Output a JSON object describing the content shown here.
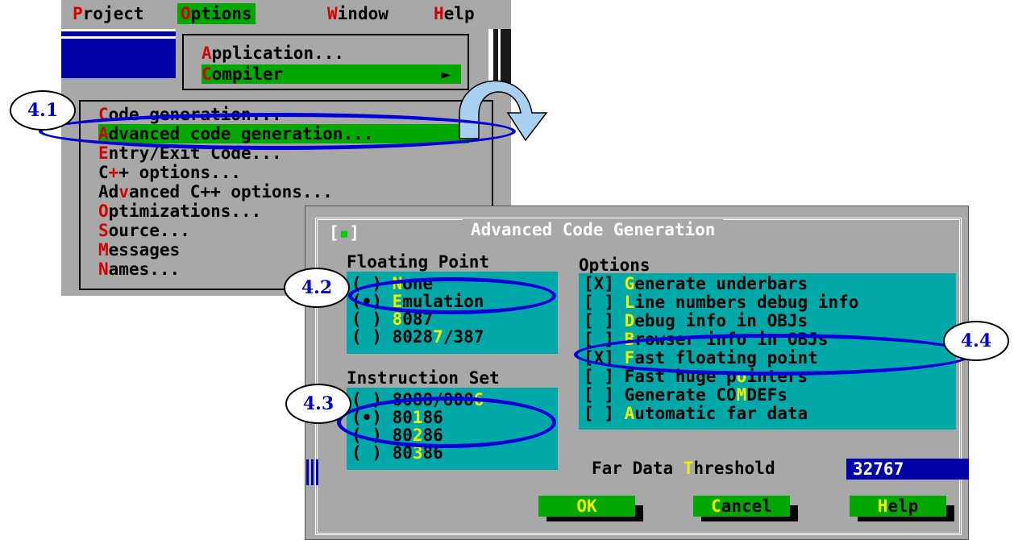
{
  "menubar": {
    "items": [
      {
        "label": "Project",
        "hotkey": "P"
      },
      {
        "label": "Options",
        "hotkey": "O"
      },
      {
        "label": "Window",
        "hotkey": "W"
      },
      {
        "label": "Help",
        "hotkey": "H"
      }
    ]
  },
  "options_menu": {
    "application": "Application...",
    "compiler": "Compiler",
    "compiler_arrow": "►"
  },
  "compiler_menu": {
    "items": [
      "Code generation...",
      "Advanced code generation...",
      "Entry/Exit Code...",
      "C++ options...",
      "Advanced C++ options...",
      "Optimizations...",
      "Source...",
      "Messages",
      "Names..."
    ]
  },
  "dialog": {
    "title": "Advanced Code Generation",
    "close_box": "[",
    "close_dot": "▪",
    "close_end": "]",
    "floating_point": {
      "title": "Floating Point",
      "options": [
        "None",
        "Emulation",
        "8087",
        "80287/387"
      ],
      "selected": "Emulation"
    },
    "instruction_set": {
      "title": "Instruction Set",
      "options": [
        "8088/8086",
        "80186",
        "80286",
        "80386"
      ],
      "selected": "80186"
    },
    "options": {
      "title": "Options",
      "items": [
        {
          "label": "Generate underbars",
          "checked": true
        },
        {
          "label": "Line numbers debug info",
          "checked": false
        },
        {
          "label": "Debug info in OBJs",
          "checked": false
        },
        {
          "label": "Browser info in OBJs",
          "checked": false
        },
        {
          "label": "Fast floating point",
          "checked": true
        },
        {
          "label": "Fast huge pointers",
          "checked": false
        },
        {
          "label": "Generate COMDEFs",
          "checked": false
        },
        {
          "label": "Automatic far data",
          "checked": false
        }
      ]
    },
    "far_data_threshold": {
      "label": "Far Data Threshold",
      "value": "32767"
    },
    "buttons": {
      "ok": "OK",
      "cancel": "Cancel",
      "help": "Help"
    }
  },
  "annotations": {
    "c41": "4.1",
    "c42": "4.2",
    "c43": "4.3",
    "c44": "4.4"
  },
  "colors": {
    "menu_bg": "#a8a8a8",
    "highlight_green": "#00a800",
    "dialog_cyan": "#00a8a8",
    "input_blue": "#0000a8",
    "hotkey_red": "#d40000",
    "hotkey_yellow": "#f0f000",
    "annotation_blue": "#0000d8",
    "arrow_fill": "#a8d0f0"
  }
}
